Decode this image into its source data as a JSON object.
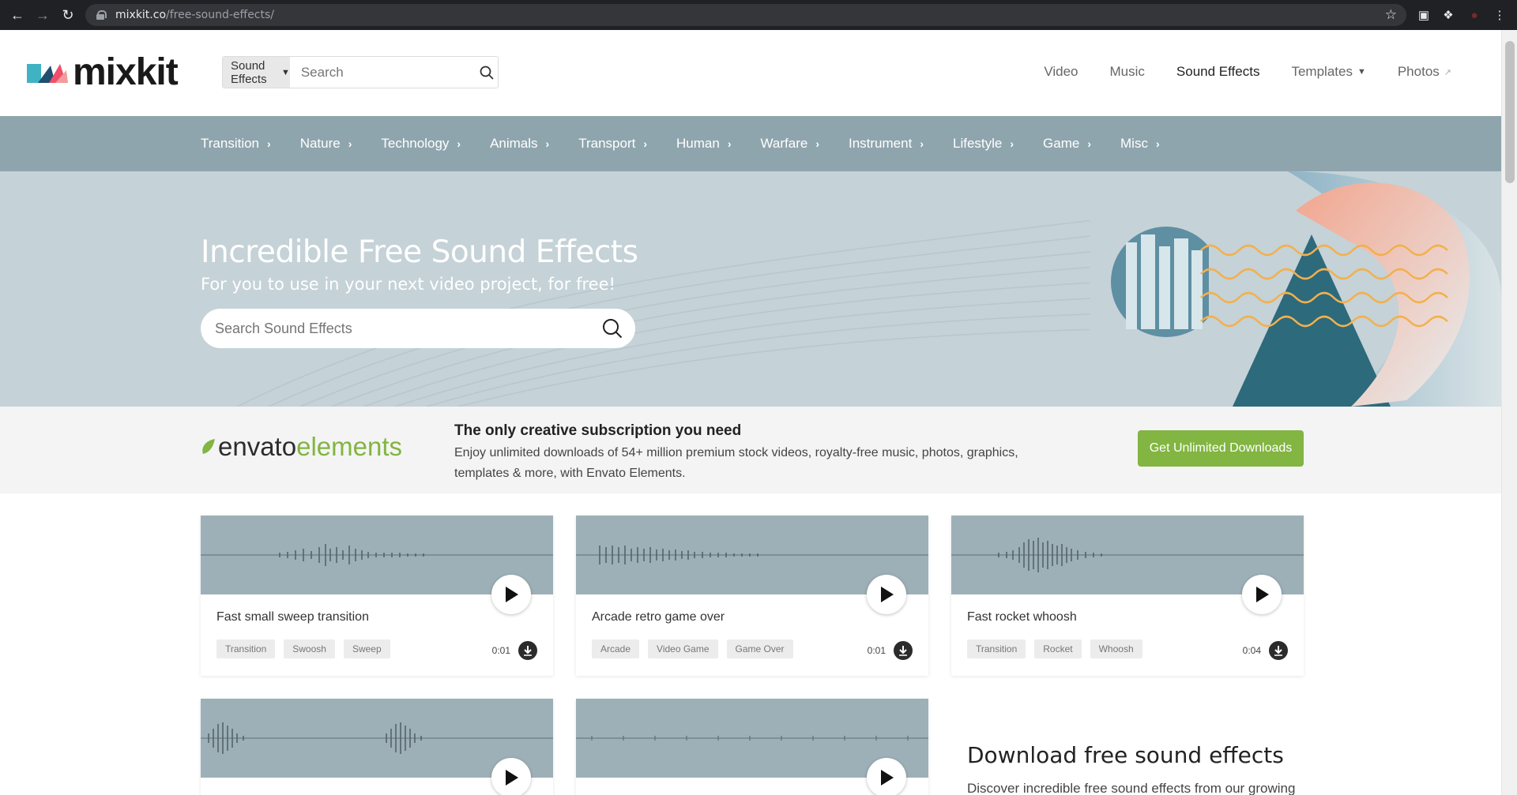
{
  "browser": {
    "url_host": "mixkit.co",
    "url_path": "/free-sound-effects/"
  },
  "header": {
    "logo_text": "mixkit",
    "search": {
      "category": "Sound Effects",
      "placeholder": "Search"
    },
    "nav": [
      {
        "label": "Video"
      },
      {
        "label": "Music"
      },
      {
        "label": "Sound Effects"
      },
      {
        "label": "Templates"
      },
      {
        "label": "Photos"
      }
    ]
  },
  "categories": [
    "Transition",
    "Nature",
    "Technology",
    "Animals",
    "Transport",
    "Human",
    "Warfare",
    "Instrument",
    "Lifestyle",
    "Game",
    "Misc"
  ],
  "hero": {
    "title": "Incredible Free Sound Effects",
    "subtitle": "For you to use in your next video project, for free!",
    "search_placeholder": "Search Sound Effects"
  },
  "envato": {
    "logo_part1": "envato",
    "logo_part2": "elements",
    "headline": "The only creative subscription you need",
    "description": "Enjoy unlimited downloads of 54+ million premium stock videos, royalty-free music, photos, graphics, templates & more, with Envato Elements.",
    "cta": "Get Unlimited Downloads"
  },
  "sounds": [
    {
      "title": "Fast small sweep transition",
      "tags": [
        "Transition",
        "Swoosh",
        "Sweep"
      ],
      "duration": "0:01"
    },
    {
      "title": "Arcade retro game over",
      "tags": [
        "Arcade",
        "Video Game",
        "Game Over"
      ],
      "duration": "0:01"
    },
    {
      "title": "Fast rocket whoosh",
      "tags": [
        "Transition",
        "Rocket",
        "Whoosh"
      ],
      "duration": "0:04"
    }
  ],
  "promo": {
    "title": "Download free sound effects",
    "text": "Discover incredible free sound effects from our growing"
  },
  "colors": {
    "accent_green": "#82b541",
    "category_bar": "#8fa5ad",
    "hero_bg": "#c5d2d7",
    "waveform_bg": "#9eb0b7"
  }
}
